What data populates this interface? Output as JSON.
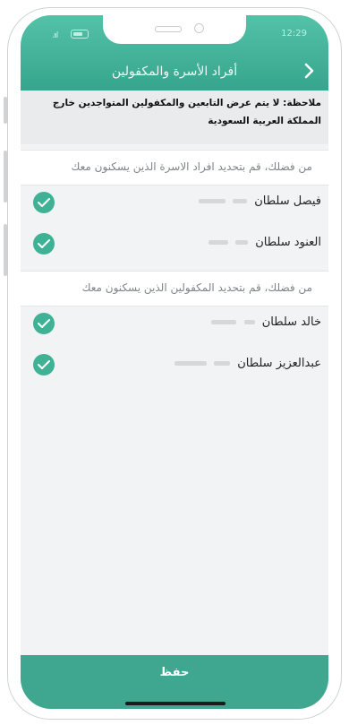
{
  "status_bar": {
    "time": "12:29",
    "signal": ".ııl"
  },
  "header": {
    "title": "أفراد الأسرة والمكفولين",
    "back_symbol": "›"
  },
  "note": {
    "text": "ملاحظة: لا يتم عرض التابعين والمكفولين المتواجدين خارج المملكة العربية السعودية"
  },
  "family_section": {
    "instruction": "من فضلك، قم بتحديد افراد الاسرة الذين يسكنون معك",
    "members": [
      {
        "name": "فيصل سلطان",
        "checked": true
      },
      {
        "name": "العنود سلطان",
        "checked": true
      }
    ]
  },
  "sponsored_section": {
    "instruction": "من فضلك، قم بتحديد المكفولين الذين يسكنون معك",
    "members": [
      {
        "name": "خالد سلطان",
        "checked": true
      },
      {
        "name": "عبدالعزيز سلطان",
        "checked": true
      }
    ]
  },
  "actions": {
    "save_label": "حفظ"
  },
  "colors": {
    "accent": "#3fa68f",
    "header_top": "#53c2a8",
    "check": "#3fb296"
  }
}
